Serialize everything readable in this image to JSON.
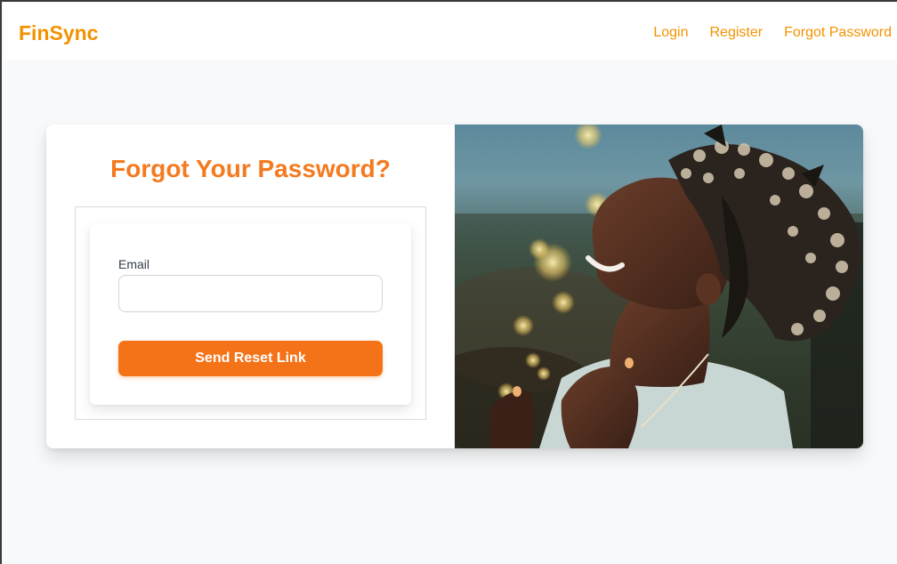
{
  "brand": {
    "name": "FinSync"
  },
  "nav": {
    "links": [
      {
        "label": "Login"
      },
      {
        "label": "Register"
      },
      {
        "label": "Forgot Password"
      }
    ]
  },
  "form": {
    "title": "Forgot Your Password?",
    "email_label": "Email",
    "email_value": "",
    "email_placeholder": "",
    "submit_label": "Send Reset Link"
  },
  "theme": {
    "accent": "#f39200",
    "button": "#f47318",
    "title": "#f47a1f"
  }
}
